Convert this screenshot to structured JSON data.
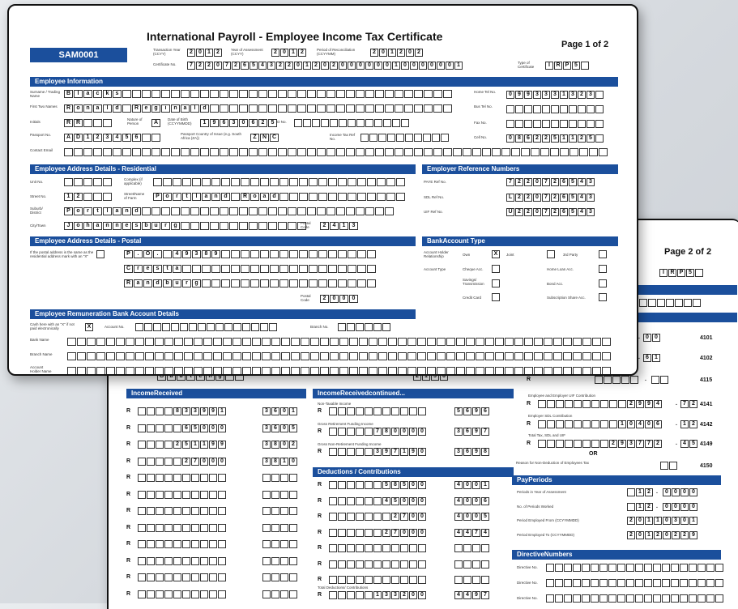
{
  "page1": {
    "title": "International Payroll - Employee Income Tax Certificate",
    "page_label": "Page 1 of 2",
    "reference": "SAM0001",
    "header": {
      "transaction_year_label": "Transaction Year (CCYY)",
      "transaction_year": "2012",
      "year_of_assessment_label": "Year of Assessment (CCYY)",
      "year_of_assessment": "2012",
      "period_label": "Period of Reconciliation (CCYYMM)",
      "period": "201202",
      "certificate_no_label": "Certificate No.",
      "certificate_no": "7220726543220120200000010000001",
      "type_label": "Type of Certificate",
      "type": "IRP5"
    },
    "employee_info": {
      "heading": "Employee Information",
      "surname_label": "Surname / Trading Name",
      "surname": "Blacks",
      "first_names_label": "First Two Names",
      "first_names": "Ronald Reginald",
      "initials_label": "Initials",
      "initials": "RR",
      "nature_label": "Nature of Person",
      "nature": "A",
      "dob_label": "Date of Birth (CCYYMMDD)",
      "dob": "19630625",
      "id_label": "ID No.",
      "passport_label": "Passport No.",
      "passport": "AD123456",
      "country_label": "Passport Country of Issue (e.g. South Africa (ZA))",
      "country": "ZNC",
      "income_tax_label": "Income Tax Ref No.",
      "contact_label": "Contact Email",
      "home_tel_label": "Home Tel No.",
      "home_tel": "0993331323",
      "bus_tel_label": "Bus Tel No.",
      "fax_label": "Fax No.",
      "cell_label": "Cell No.",
      "cell": "0862251125"
    },
    "address_res": {
      "heading": "Employee Address Details - Residential",
      "unit_label": "Unit No.",
      "complex_label": "Complex (if applicable)",
      "street_no_label": "Street No.",
      "street_no": "12",
      "street_label": "Street/Name of Farm",
      "street": "Portland Road",
      "suburb_label": "Suburb/ District",
      "suburb": "Portland",
      "city_label": "City/Town",
      "city": "Johannesburg",
      "postal_label": "Postal Code",
      "postal": "2413"
    },
    "employer_ref": {
      "heading": "Employer Reference Numbers",
      "paye_label": "PAYE Ref No.",
      "paye": "7220726543",
      "sdl_label": "SDL Ref No.",
      "sdl": "L220726543",
      "uif_label": "UIF Ref No.",
      "uif": "U220726543"
    },
    "address_post": {
      "heading": "Employee Address Details - Postal",
      "same_label": "If the postal address is the same as the residential address mark with an \"X\"",
      "line1": "P.O. 49389",
      "line2": "Cresta",
      "line3": "Randburg",
      "postal_label": "Postal Code",
      "postal": "2000"
    },
    "bank_type": {
      "heading": "BankAccount Type",
      "holder_label": "Account Holder Relationship",
      "own_label": "Own",
      "own_value": "X",
      "joint_label": "Joint",
      "third_label": "3rd Party",
      "account_type_label": "Account Type",
      "cheque_label": "Cheque Acc.",
      "home_loan_label": "Home Loan Acc.",
      "savings_label": "Savings/ Transmission",
      "bond_label": "Bond Acc.",
      "credit_label": "Credit Card",
      "sub_label": "Subscription Share Acc."
    },
    "remuneration_bank": {
      "heading": "Employee Remuneration Bank Account Details",
      "cash_label": "Cash here with an \"X\" if not paid electronically",
      "cash_value": "X",
      "account_label": "Account No.",
      "branch_label": "Branch No.",
      "bank_name_label": "Bank Name",
      "branch_name_label": "Branch Name",
      "holder_label": "Account Holder Name"
    }
  },
  "page2": {
    "page_label": "Page 2 of 2",
    "type": "IRP5",
    "province": "Gauteng",
    "postal": "2156",
    "income_received": {
      "heading": "IncomeReceived",
      "rows": [
        {
          "amount": "833991",
          "code": "3601"
        },
        {
          "amount": "65000",
          "code": "3605"
        },
        {
          "amount": "251199",
          "code": "3802"
        },
        {
          "amount": "27000",
          "code": "3810"
        },
        {
          "amount": "",
          "code": ""
        },
        {
          "amount": "",
          "code": ""
        },
        {
          "amount": "",
          "code": ""
        },
        {
          "amount": "",
          "code": ""
        },
        {
          "amount": "",
          "code": ""
        },
        {
          "amount": "",
          "code": ""
        },
        {
          "amount": "",
          "code": ""
        },
        {
          "amount": "",
          "code": ""
        }
      ]
    },
    "income_cont": {
      "heading": "IncomeReceivedcontinued...",
      "rows": [
        {
          "label": "Non-Taxable Income",
          "amount": "",
          "code": "5696"
        },
        {
          "label": "Gross Retirement Funding Income",
          "amount": "780000",
          "code": "3697"
        },
        {
          "label": "Gross Non-Retirement Funding Income",
          "amount": "397190",
          "code": "3698"
        }
      ]
    },
    "deductions": {
      "heading": "Deductions / Contributions",
      "rows": [
        {
          "amount": "58500",
          "code": "4001"
        },
        {
          "amount": "45000",
          "code": "4006"
        },
        {
          "amount": "2700",
          "code": "4005"
        },
        {
          "amount": "27000",
          "code": "4474"
        },
        {
          "amount": "",
          "code": ""
        },
        {
          "amount": "",
          "code": ""
        },
        {
          "amount": "",
          "code": ""
        }
      ],
      "total_label": "Total Deductions/ Contributions",
      "total_amount": "133200",
      "total_code": "4497"
    },
    "tax_rows": [
      {
        "int": "5",
        "dec": "00",
        "code": "4101"
      },
      {
        "int": "6",
        "dec": "61",
        "code": "4102"
      },
      {
        "int": "",
        "dec": "",
        "code": "4115"
      },
      {
        "label": "Employee and Employer UIF Contribution",
        "int": "2994",
        "dec": "72",
        "code": "4141"
      },
      {
        "label": "Employer SDL Contribution",
        "int": "10406",
        "dec": "12",
        "code": "4142"
      },
      {
        "label": "Total Tax, SDL and UIF",
        "int": "293772",
        "dec": "45",
        "code": "4149"
      }
    ],
    "or_label": "OR",
    "reason_label": "Reason for Non-Deduction of Employees Tax",
    "reason_code": "4150",
    "pay_periods": {
      "heading": "PayPeriods",
      "rows": [
        {
          "label": "Periods in Year of Assessment",
          "int": "12",
          "dec": "0000"
        },
        {
          "label": "No. of Periods Worked",
          "int": "12",
          "dec": "0000"
        },
        {
          "label": "Period Employed From (CCYYMMDD)",
          "value": "20110301"
        },
        {
          "label": "Period Employed To (CCYYMMDD)",
          "value": "20120229"
        }
      ]
    },
    "directive": {
      "heading": "DirectiveNumbers",
      "rows": [
        "Directive No.",
        "Directive No.",
        "Directive No."
      ]
    }
  }
}
